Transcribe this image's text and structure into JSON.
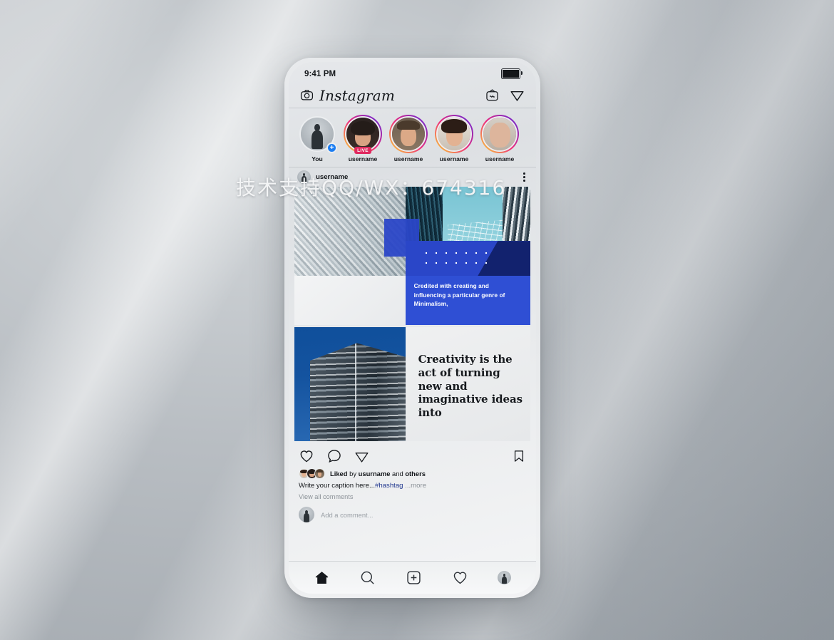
{
  "watermark": {
    "text": "技术支持QQ/WX：674316"
  },
  "phone": {
    "status": {
      "time": "9:41 PM",
      "battery_icon": "battery-full-icon"
    }
  },
  "header": {
    "camera_icon": "camera-icon",
    "logo": "Instagram",
    "igtv_icon": "igtv-icon",
    "messenger_icon": "paper-plane-icon"
  },
  "stories": {
    "items": [
      {
        "label": "You",
        "your_story": true,
        "has_ring": false,
        "live": false
      },
      {
        "label": "username",
        "your_story": false,
        "has_ring": true,
        "live": true,
        "live_label": "LIVE"
      },
      {
        "label": "username",
        "your_story": false,
        "has_ring": true,
        "live": false
      },
      {
        "label": "username",
        "your_story": false,
        "has_ring": true,
        "live": false
      },
      {
        "label": "username",
        "your_story": false,
        "has_ring": true,
        "live": false
      }
    ]
  },
  "post": {
    "author": "username",
    "more_icon": "three-dots-icon",
    "blue_caption": "Credited with creating and influencing a particular genre of Minimalism,",
    "headline": "Creativity is the act of turning new and imaginative ideas into",
    "actions": {
      "like_icon": "heart-icon",
      "comment_icon": "comment-bubble-icon",
      "share_icon": "paper-plane-icon",
      "save_icon": "bookmark-icon"
    },
    "liked_prefix": "Liked",
    "liked_by": "by",
    "liked_user": "usurname",
    "liked_and": "and",
    "liked_others": "others",
    "caption_text": "Write your caption here...",
    "caption_hashtag": "#hashtag",
    "caption_more": "...more",
    "view_all_comments": "View all comments",
    "add_comment_placeholder": "Add a comment..."
  },
  "tabbar": {
    "items": [
      {
        "name": "home-icon"
      },
      {
        "name": "search-icon"
      },
      {
        "name": "add-post-icon"
      },
      {
        "name": "activity-heart-icon"
      },
      {
        "name": "profile-avatar"
      }
    ]
  },
  "colors": {
    "accent_blue": "#2f4fd4",
    "deep_blue": "#12226e",
    "live_badge": "#e0295f",
    "plus_blue": "#1d7ef2",
    "hashtag": "#22398f"
  }
}
